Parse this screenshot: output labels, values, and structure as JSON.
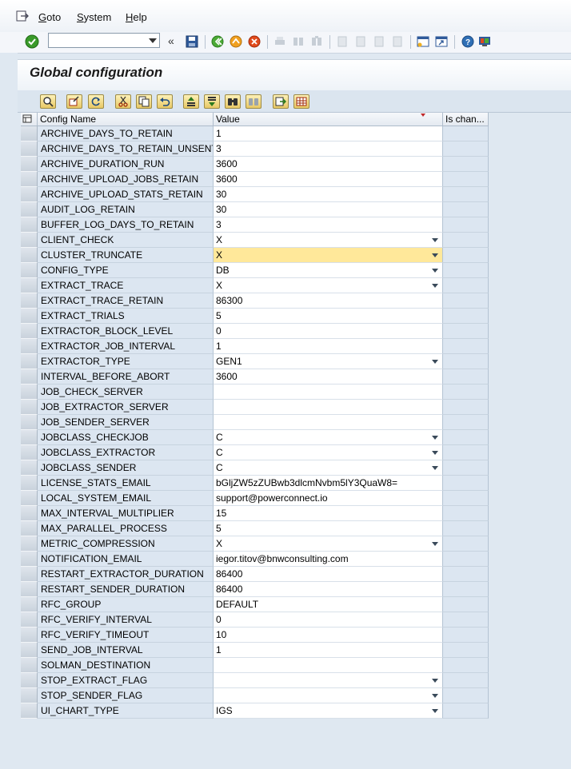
{
  "menu": {
    "goto": "Goto",
    "system": "System",
    "help": "Help"
  },
  "command_field": {
    "value": ""
  },
  "toolbar": {
    "back_arrows": "«"
  },
  "page": {
    "title": "Global configuration"
  },
  "grid": {
    "columns": {
      "config_name": "Config Name",
      "value": "Value",
      "is_changed": "Is chan..."
    },
    "rows": [
      {
        "name": "ARCHIVE_DAYS_TO_RETAIN",
        "value": "1",
        "dropdown": false
      },
      {
        "name": "ARCHIVE_DAYS_TO_RETAIN_UNSENT",
        "value": "3",
        "dropdown": false
      },
      {
        "name": "ARCHIVE_DURATION_RUN",
        "value": "3600",
        "dropdown": false
      },
      {
        "name": "ARCHIVE_UPLOAD_JOBS_RETAIN",
        "value": "3600",
        "dropdown": false
      },
      {
        "name": "ARCHIVE_UPLOAD_STATS_RETAIN",
        "value": "30",
        "dropdown": false
      },
      {
        "name": "AUDIT_LOG_RETAIN",
        "value": "30",
        "dropdown": false
      },
      {
        "name": "BUFFER_LOG_DAYS_TO_RETAIN",
        "value": "3",
        "dropdown": false
      },
      {
        "name": "CLIENT_CHECK",
        "value": "X",
        "dropdown": true
      },
      {
        "name": "CLUSTER_TRUNCATE",
        "value": "X",
        "dropdown": true,
        "focused": true
      },
      {
        "name": "CONFIG_TYPE",
        "value": "DB",
        "dropdown": true
      },
      {
        "name": "EXTRACT_TRACE",
        "value": "X",
        "dropdown": true
      },
      {
        "name": "EXTRACT_TRACE_RETAIN",
        "value": "86300",
        "dropdown": false
      },
      {
        "name": "EXTRACT_TRIALS",
        "value": "5",
        "dropdown": false
      },
      {
        "name": "EXTRACTOR_BLOCK_LEVEL",
        "value": "0",
        "dropdown": false
      },
      {
        "name": "EXTRACTOR_JOB_INTERVAL",
        "value": "1",
        "dropdown": false
      },
      {
        "name": "EXTRACTOR_TYPE",
        "value": "GEN1",
        "dropdown": true
      },
      {
        "name": "INTERVAL_BEFORE_ABORT",
        "value": "3600",
        "dropdown": false
      },
      {
        "name": "JOB_CHECK_SERVER",
        "value": "",
        "dropdown": false
      },
      {
        "name": "JOB_EXTRACTOR_SERVER",
        "value": "",
        "dropdown": false
      },
      {
        "name": "JOB_SENDER_SERVER",
        "value": "",
        "dropdown": false
      },
      {
        "name": "JOBCLASS_CHECKJOB",
        "value": "C",
        "dropdown": true
      },
      {
        "name": "JOBCLASS_EXTRACTOR",
        "value": "C",
        "dropdown": true
      },
      {
        "name": "JOBCLASS_SENDER",
        "value": "C",
        "dropdown": true
      },
      {
        "name": "LICENSE_STATS_EMAIL",
        "value": "bGljZW5zZUBwb3dlcmNvbm5lY3QuaW8=",
        "dropdown": false
      },
      {
        "name": "LOCAL_SYSTEM_EMAIL",
        "value": "support@powerconnect.io",
        "dropdown": false
      },
      {
        "name": "MAX_INTERVAL_MULTIPLIER",
        "value": "15",
        "dropdown": false
      },
      {
        "name": "MAX_PARALLEL_PROCESS",
        "value": "5",
        "dropdown": false
      },
      {
        "name": "METRIC_COMPRESSION",
        "value": "X",
        "dropdown": true
      },
      {
        "name": "NOTIFICATION_EMAIL",
        "value": "iegor.titov@bnwconsulting.com",
        "dropdown": false
      },
      {
        "name": "RESTART_EXTRACTOR_DURATION",
        "value": "86400",
        "dropdown": false
      },
      {
        "name": "RESTART_SENDER_DURATION",
        "value": "86400",
        "dropdown": false
      },
      {
        "name": "RFC_GROUP",
        "value": "DEFAULT",
        "dropdown": false
      },
      {
        "name": "RFC_VERIFY_INTERVAL",
        "value": "0",
        "dropdown": false
      },
      {
        "name": "RFC_VERIFY_TIMEOUT",
        "value": "10",
        "dropdown": false
      },
      {
        "name": "SEND_JOB_INTERVAL",
        "value": "1",
        "dropdown": false
      },
      {
        "name": "SOLMAN_DESTINATION",
        "value": "",
        "dropdown": false
      },
      {
        "name": "STOP_EXTRACT_FLAG",
        "value": "",
        "dropdown": true
      },
      {
        "name": "STOP_SENDER_FLAG",
        "value": "",
        "dropdown": true
      },
      {
        "name": "UI_CHART_TYPE",
        "value": "IGS",
        "dropdown": true
      }
    ]
  },
  "colors": {
    "background": "#dfe8f1",
    "focus_cell": "#ffe89a",
    "alv_button": "#e8c865"
  }
}
